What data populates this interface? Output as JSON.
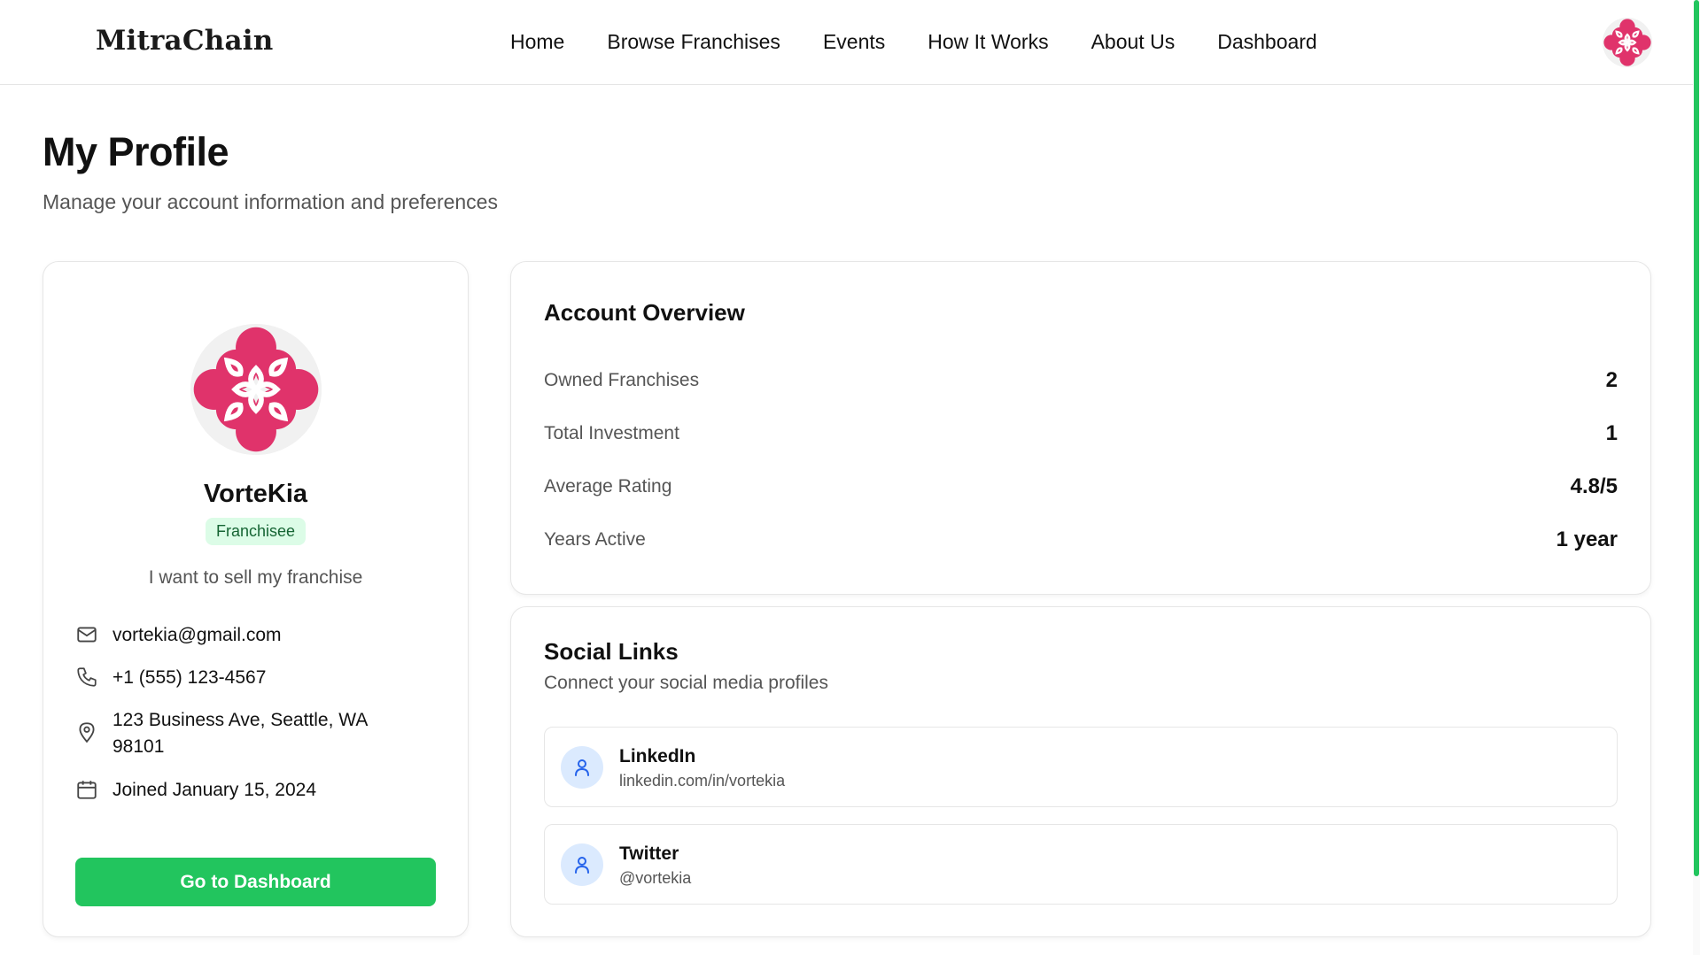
{
  "header": {
    "logo": "MitraChain",
    "nav": [
      "Home",
      "Browse Franchises",
      "Events",
      "How It Works",
      "About Us",
      "Dashboard"
    ]
  },
  "page": {
    "title": "My Profile",
    "subtitle": "Manage your account information and preferences"
  },
  "profile": {
    "name": "VorteKia",
    "role": "Franchisee",
    "bio": "I want to sell my franchise",
    "email": "vortekia@gmail.com",
    "phone": "+1 (555) 123-4567",
    "address": "123 Business Ave, Seattle, WA 98101",
    "joined": "Joined January 15, 2024",
    "button": "Go to Dashboard"
  },
  "overview": {
    "title": "Account Overview",
    "stats": [
      {
        "label": "Owned Franchises",
        "value": "2"
      },
      {
        "label": "Total Investment",
        "value": "1"
      },
      {
        "label": "Average Rating",
        "value": "4.8/5"
      },
      {
        "label": "Years Active",
        "value": "1 year"
      }
    ]
  },
  "social": {
    "title": "Social Links",
    "subtitle": "Connect your social media profiles",
    "links": [
      {
        "name": "LinkedIn",
        "handle": "linkedin.com/in/vortekia"
      },
      {
        "name": "Twitter",
        "handle": "@vortekia"
      }
    ]
  },
  "colors": {
    "accent": "#22c55e",
    "brand_pink": "#e0336b",
    "badge_bg": "#dcfce7",
    "badge_text": "#166534",
    "icon_bg": "#dbeafe",
    "icon_fg": "#2563eb"
  },
  "icons": {
    "avatar": "flower-logo-icon",
    "email": "mail-icon",
    "phone": "phone-icon",
    "address": "map-pin-icon",
    "joined": "calendar-icon",
    "social": "user-icon"
  }
}
